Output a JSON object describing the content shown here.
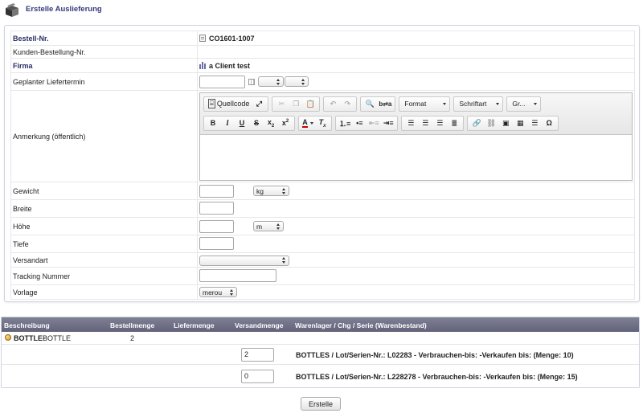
{
  "header": {
    "title": "Erstelle Auslieferung",
    "icon": "box-icon"
  },
  "form": {
    "order_ref": {
      "label": "Bestell-Nr.",
      "value": "CO1601-1007"
    },
    "customer_ref": {
      "label": "Kunden-Bestellung-Nr.",
      "value": ""
    },
    "company": {
      "label": "Firma",
      "value": "a Client test"
    },
    "delivery_date": {
      "label": "Geplanter Liefertermin",
      "value": "",
      "hour": "",
      "minute": ""
    },
    "note": {
      "label": "Anmerkung (öffentlich)"
    },
    "weight": {
      "label": "Gewicht",
      "value": "",
      "unit": "kg"
    },
    "width": {
      "label": "Breite",
      "value": ""
    },
    "height": {
      "label": "Höhe",
      "value": "",
      "unit": "m"
    },
    "depth": {
      "label": "Tiefe",
      "value": ""
    },
    "shipping_method": {
      "label": "Versandart",
      "value": ""
    },
    "tracking": {
      "label": "Tracking Nummer",
      "value": ""
    },
    "template": {
      "label": "Vorlage",
      "value": "merou"
    }
  },
  "editor": {
    "source_label": "Quellcode",
    "format_label": "Format",
    "font_label": "Schriftart",
    "size_label": "Gr..."
  },
  "items": {
    "columns": [
      "Beschreibung",
      "Bestellmenge",
      "Liefermenge",
      "Versandmenge",
      "Warenlager / Chg / Serie (Warenbestand)"
    ],
    "product": {
      "code": "BOTTLE",
      "separator": " - ",
      "name": "BOTTLE",
      "ordered": "2"
    },
    "lots": [
      {
        "qty": "2",
        "info": "BOTTLES / Lot/Serien-Nr.: L02283 - Verbrauchen-bis: -Verkaufen bis: (Menge: 10)"
      },
      {
        "qty": "0",
        "info": "BOTTLES / Lot/Serien-Nr.: L228278 - Verbrauchen-bis: -Verkaufen bis: (Menge: 15)"
      }
    ]
  },
  "actions": {
    "submit_label": "Erstelle"
  }
}
